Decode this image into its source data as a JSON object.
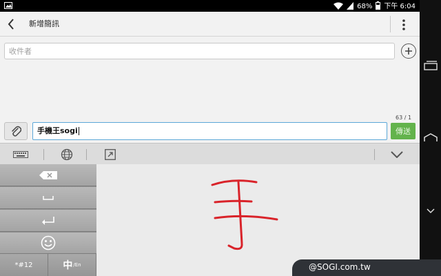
{
  "status_bar": {
    "battery": "68%",
    "time": "下午 6:04",
    "icons": [
      "image-icon",
      "wifi-icon",
      "signal-icon",
      "battery-icon"
    ]
  },
  "header": {
    "title": "新增簡訊",
    "back_icon": "chevron-left-icon",
    "overflow_icon": "more-vertical-icon"
  },
  "recipient": {
    "placeholder": "收件者",
    "value": "",
    "add_icon": "plus-circle-icon"
  },
  "compose": {
    "counter": "63 / 1",
    "message": "手機王sogi",
    "send_label": "傳送",
    "attach_icon": "paperclip-icon"
  },
  "ime_toolbar": {
    "icons": [
      "keyboard-icon",
      "globe-icon",
      "expand-icon",
      "chevron-down-icon"
    ]
  },
  "ime_keys": {
    "symbols_label": "*#12",
    "lang_label_main": "中",
    "lang_label_sub": "/En",
    "icons": [
      "backspace-icon",
      "space-icon",
      "enter-icon",
      "smiley-icon"
    ]
  },
  "handwriting": {
    "character": "手",
    "stroke_color": "#d9232a"
  },
  "watermark": {
    "text": "@SOGI.com.tw"
  },
  "colors": {
    "send_button": "#63b34c",
    "input_focus": "#5ca7d8",
    "status_bar": "#000000"
  }
}
